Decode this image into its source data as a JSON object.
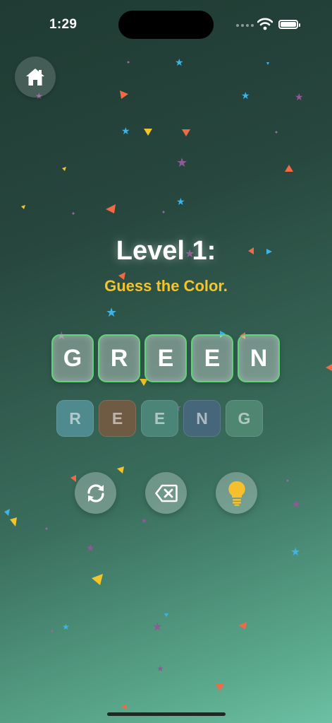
{
  "status": {
    "time": "1:29"
  },
  "level": {
    "title": "Level 1:",
    "subtitle": "Guess the Color."
  },
  "answer_tiles": [
    "G",
    "R",
    "E",
    "E",
    "N"
  ],
  "letter_pool": [
    {
      "letter": "R",
      "color": "#4f8a8f"
    },
    {
      "letter": "E",
      "color": "#6f5a44"
    },
    {
      "letter": "E",
      "color": "#4a8578"
    },
    {
      "letter": "N",
      "color": "#46667a"
    },
    {
      "letter": "G",
      "color": "#4e8672"
    }
  ],
  "controls": [
    {
      "name": "shuffle-button",
      "icon": "refresh-icon"
    },
    {
      "name": "delete-button",
      "icon": "backspace-icon"
    },
    {
      "name": "hint-button",
      "icon": "lightbulb-icon"
    }
  ],
  "colors": {
    "accent_yellow": "#f3c52a",
    "correct_border": "#63d37a"
  }
}
